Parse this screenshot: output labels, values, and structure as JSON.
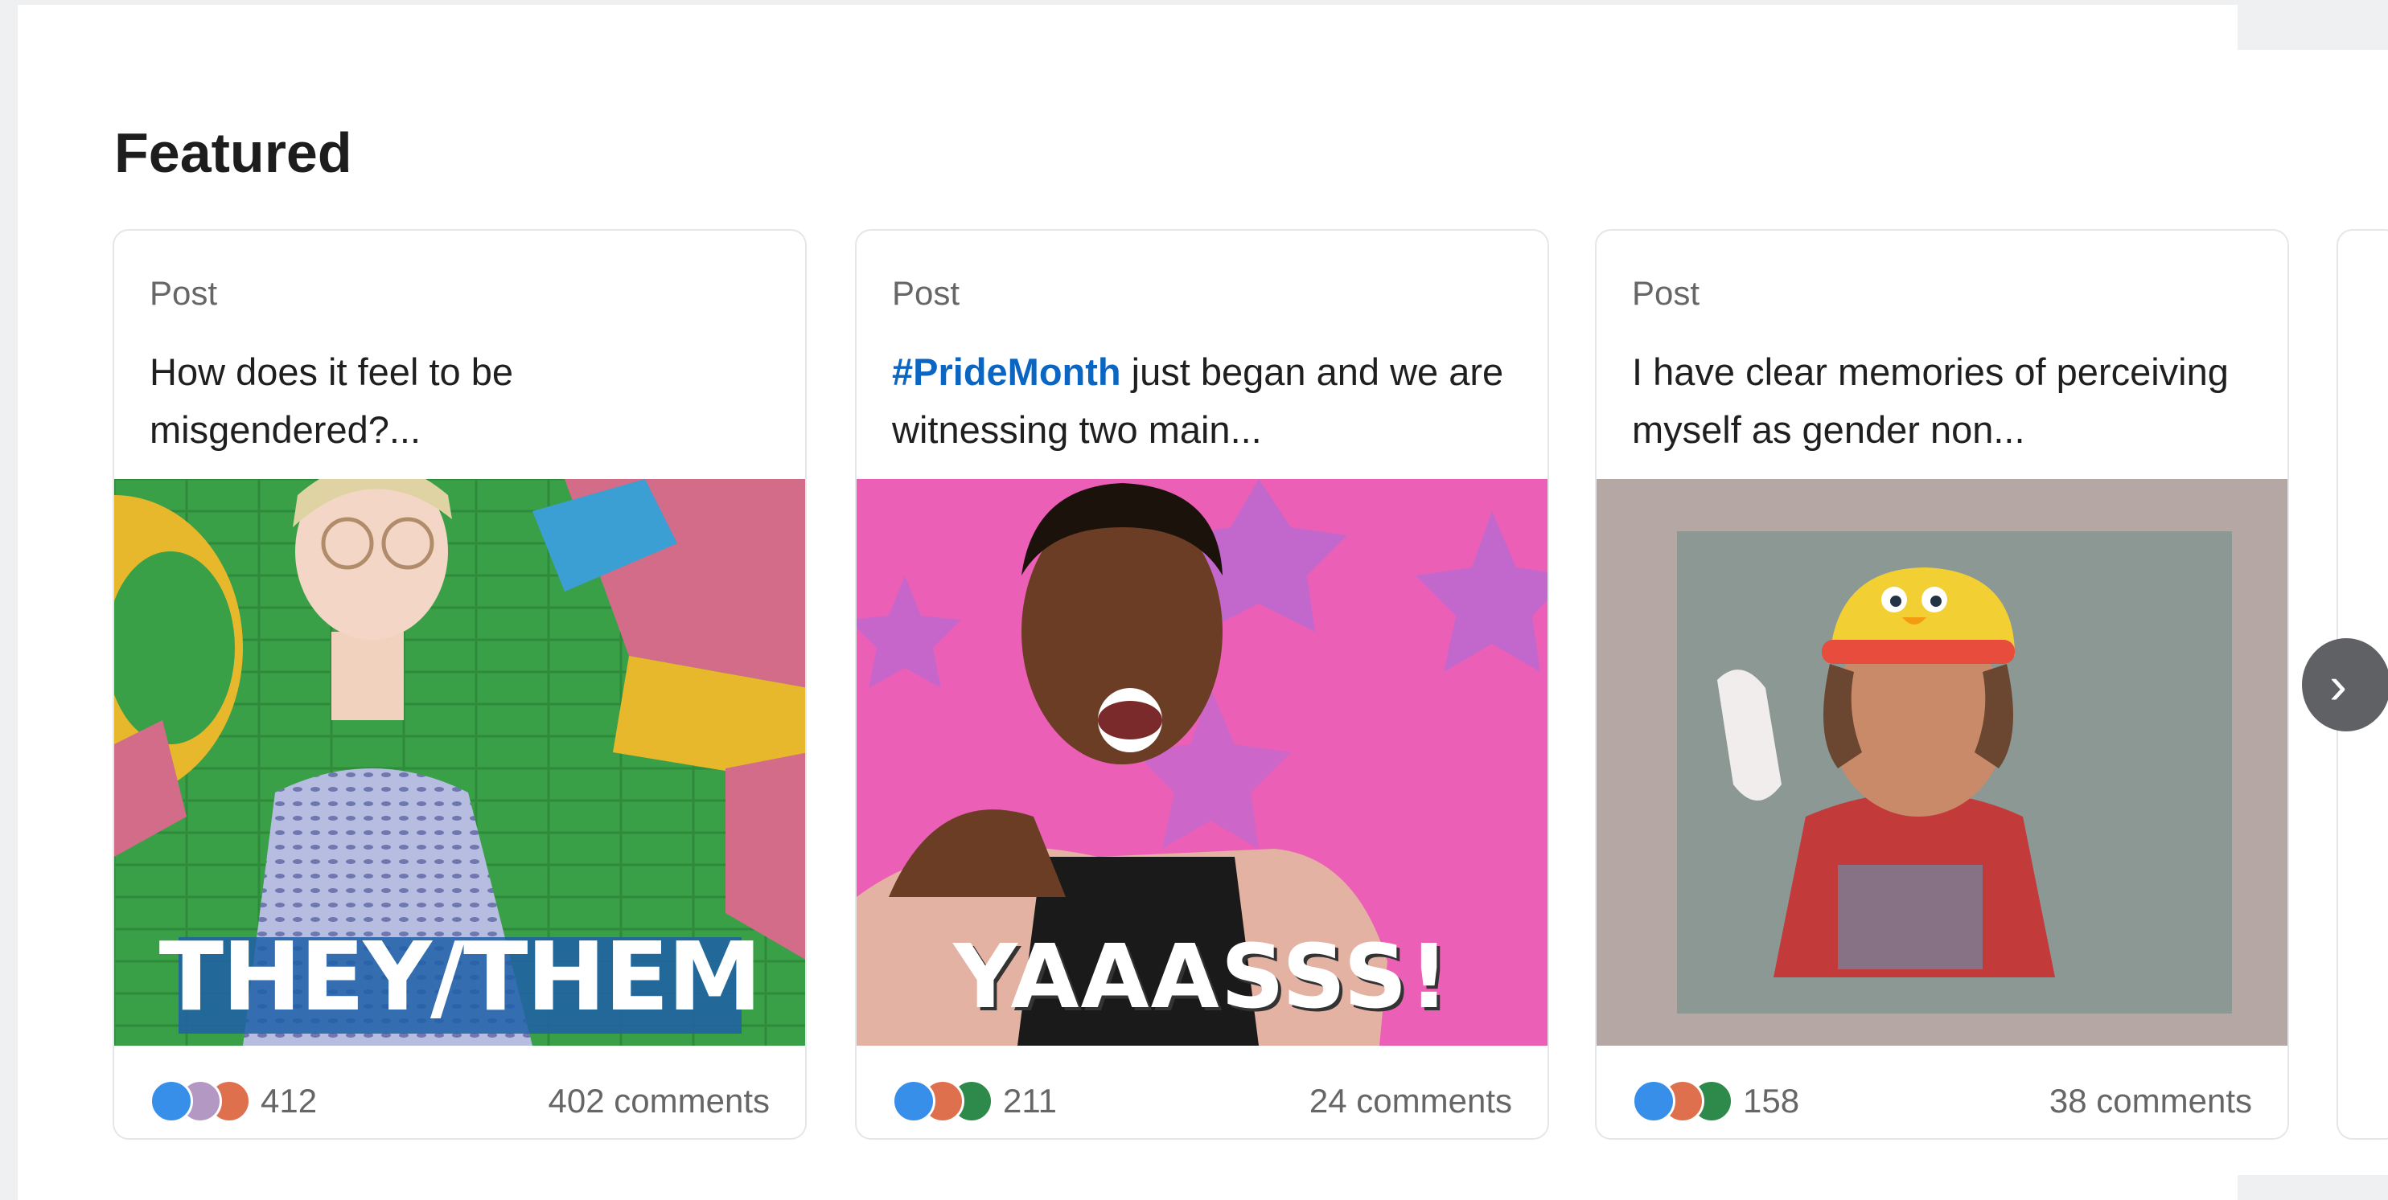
{
  "section": {
    "title": "Featured"
  },
  "cards": [
    {
      "kind": "Post",
      "hashtag": "",
      "snippet": "How does it feel to be misgendered?...",
      "image_caption": "THEY/THEM",
      "reaction_count": "412",
      "comments": "402 comments"
    },
    {
      "kind": "Post",
      "hashtag": "#PrideMonth",
      "snippet": " just began and we are witnessing two main...",
      "image_caption": "YAAASSS!",
      "reaction_count": "211",
      "comments": "24 comments"
    },
    {
      "kind": "Post",
      "hashtag": "",
      "snippet": "I have clear memories of perceiving myself as gender non...",
      "image_caption": "",
      "reaction_count": "158",
      "comments": "38 comments"
    }
  ],
  "navigation": {
    "next_icon": "chevron-right-icon",
    "next_glyph": "›"
  },
  "colors": {
    "hashtag": "#0a66c2",
    "like": "#378fe9",
    "love": "#df704d",
    "insightful": "#2e8a4b"
  }
}
